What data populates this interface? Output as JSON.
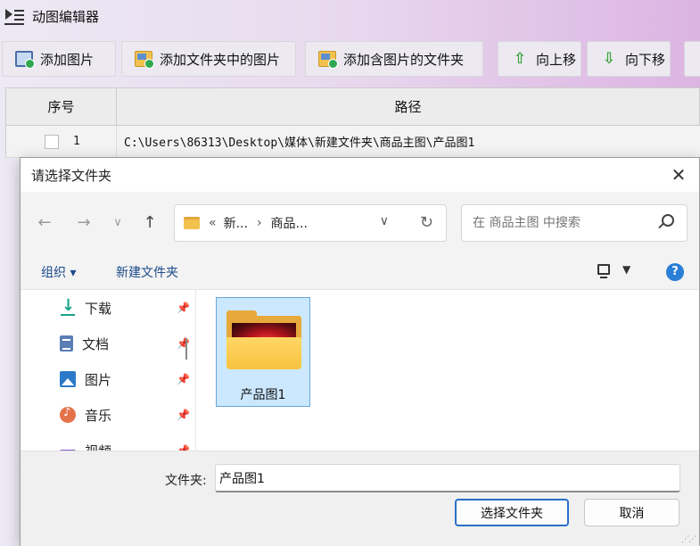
{
  "app": {
    "title": "动图编辑器"
  },
  "toolbar": {
    "add_image": "添加图片",
    "add_folder_images": "添加文件夹中的图片",
    "add_image_folders": "添加含图片的文件夹",
    "move_up": "向上移",
    "move_down": "向下移"
  },
  "table": {
    "columns": [
      "序号",
      "路径"
    ],
    "rows": [
      {
        "index": "1",
        "path": "C:\\Users\\86313\\Desktop\\媒体\\新建文件夹\\商品主图\\产品图1"
      }
    ]
  },
  "dialog": {
    "title": "请选择文件夹",
    "address": {
      "prefix": "«",
      "crumbs": [
        "新...",
        "商品..."
      ]
    },
    "search_placeholder": "在 商品主图 中搜索",
    "commands": {
      "organize": "组织 ▾",
      "new_folder": "新建文件夹"
    },
    "nav_items": [
      {
        "label": "下载",
        "icon": "download-icon"
      },
      {
        "label": "文档",
        "icon": "document-icon"
      },
      {
        "label": "图片",
        "icon": "pictures-icon"
      },
      {
        "label": "音乐",
        "icon": "music-icon"
      },
      {
        "label": "视频",
        "icon": "video-icon"
      }
    ],
    "folders": [
      {
        "name": "产品图1",
        "selected": true
      }
    ],
    "folder_label": "文件夹:",
    "folder_value": "产品图1",
    "select_button": "选择文件夹",
    "cancel_button": "取消"
  },
  "colors": {
    "accent": "#2a6fc9",
    "selection": "#cce8ff",
    "folder": "#f7c23f"
  }
}
